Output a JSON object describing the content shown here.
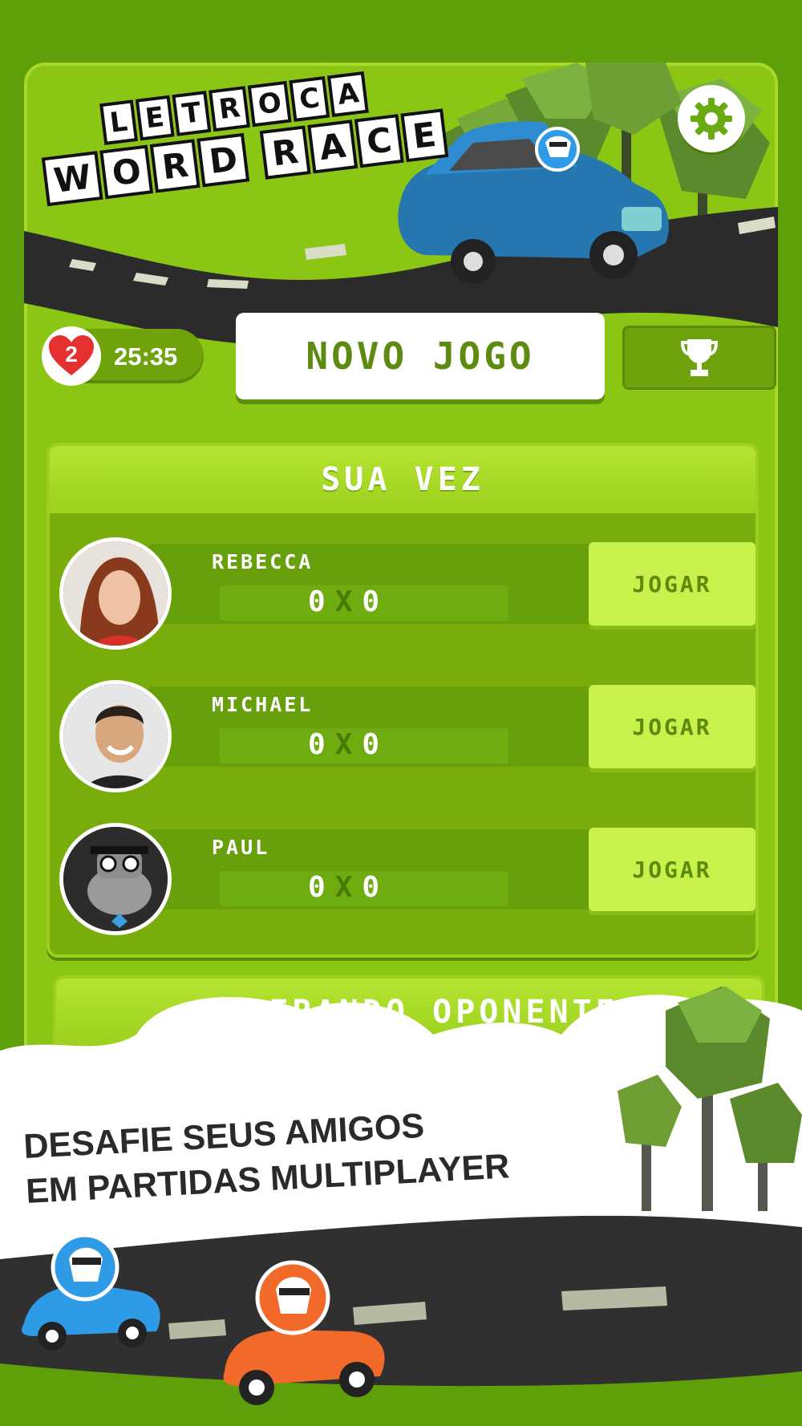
{
  "app": {
    "logo_line1": [
      "L",
      "E",
      "T",
      "R",
      "O",
      "C",
      "A"
    ],
    "logo_line2": [
      "W",
      "O",
      "R",
      "D",
      " ",
      "R",
      "A",
      "C",
      "E"
    ]
  },
  "toolbar": {
    "lives_count": "2",
    "timer": "25:35",
    "new_game_label": "NOVO JOGO"
  },
  "your_turn": {
    "title": "SUA VEZ",
    "matches": [
      {
        "name": "REBECCA",
        "score_left": "0",
        "score_sep": "X",
        "score_right": "0",
        "play_label": "JOGAR"
      },
      {
        "name": "MICHAEL",
        "score_left": "0",
        "score_sep": "X",
        "score_right": "0",
        "play_label": "JOGAR"
      },
      {
        "name": "PAUL",
        "score_left": "0",
        "score_sep": "X",
        "score_right": "0",
        "play_label": "JOGAR"
      }
    ]
  },
  "waiting": {
    "title": "ESPERANDO OPONENTE"
  },
  "promo": {
    "line1": "DESAFIE SEUS AMIGOS",
    "line2": "EM PARTIDAS MULTIPLAYER"
  },
  "colors": {
    "background": "#5fa00a",
    "panel": "#8cc614",
    "button_text": "#5e8a11",
    "play_button": "#c8f24b",
    "heart": "#e53030",
    "car_blue": "#2f9be6",
    "car_orange": "#f26a2a"
  }
}
